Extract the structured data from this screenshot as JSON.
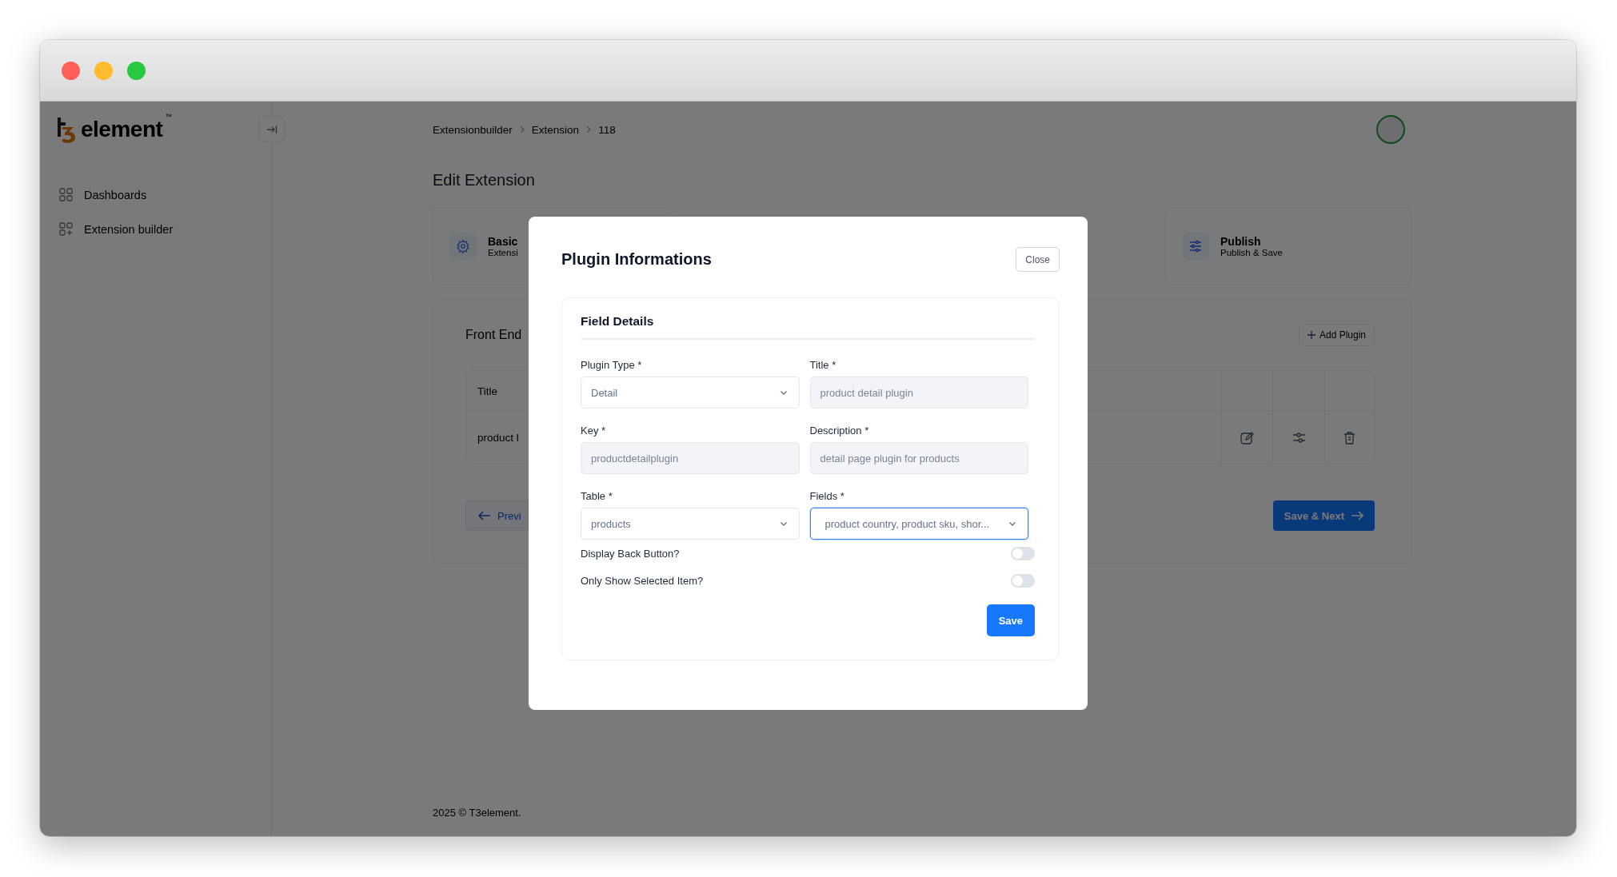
{
  "window": {
    "traffic_lights": [
      {
        "color": "#ff5f57"
      },
      {
        "color": "#febc2e"
      },
      {
        "color": "#28c840"
      }
    ]
  },
  "sidebar": {
    "logo": {
      "word": "element",
      "tm": "™"
    },
    "items": [
      {
        "label": "Dashboards"
      },
      {
        "label": "Extension builder"
      }
    ]
  },
  "header": {
    "breadcrumb": [
      "Extensionbuilder",
      "Extension",
      "118"
    ]
  },
  "page": {
    "title": "Edit Extension",
    "steps": [
      {
        "title": "Basic",
        "subtitle": "Extensi"
      },
      {
        "title": "Publish",
        "subtitle": "Publish & Save"
      }
    ],
    "section_title": "Front End",
    "add_button": "Add Plugin",
    "table": {
      "columns": [
        "Title"
      ],
      "rows": [
        {
          "title": "product l"
        }
      ]
    },
    "prev_button": "Previ",
    "next_button": "Save & Next"
  },
  "footer": "2025 ©  T3element.",
  "modal": {
    "title": "Plugin Informations",
    "close": "Close",
    "section": "Field Details",
    "fields": [
      {
        "label": "Plugin Type *",
        "value": "Detail",
        "kind": "select",
        "disabled": false,
        "focused": false
      },
      {
        "label": "Title *",
        "value": "product detail plugin",
        "kind": "text",
        "disabled": true,
        "focused": false
      },
      {
        "label": "Key *",
        "value": "productdetailplugin",
        "kind": "text",
        "disabled": true,
        "focused": false
      },
      {
        "label": "Description *",
        "value": "detail page plugin for products",
        "kind": "text",
        "disabled": true,
        "focused": false
      },
      {
        "label": "Table *",
        "value": "products",
        "kind": "select",
        "disabled": false,
        "focused": false
      },
      {
        "label": "Fields *",
        "value": "product country, product sku, shor...",
        "kind": "select",
        "disabled": false,
        "focused": true
      }
    ],
    "toggles": [
      {
        "label": "Display Back Button?",
        "on": false
      },
      {
        "label": "Only Show Selected Item?",
        "on": false
      }
    ],
    "save": "Save"
  }
}
